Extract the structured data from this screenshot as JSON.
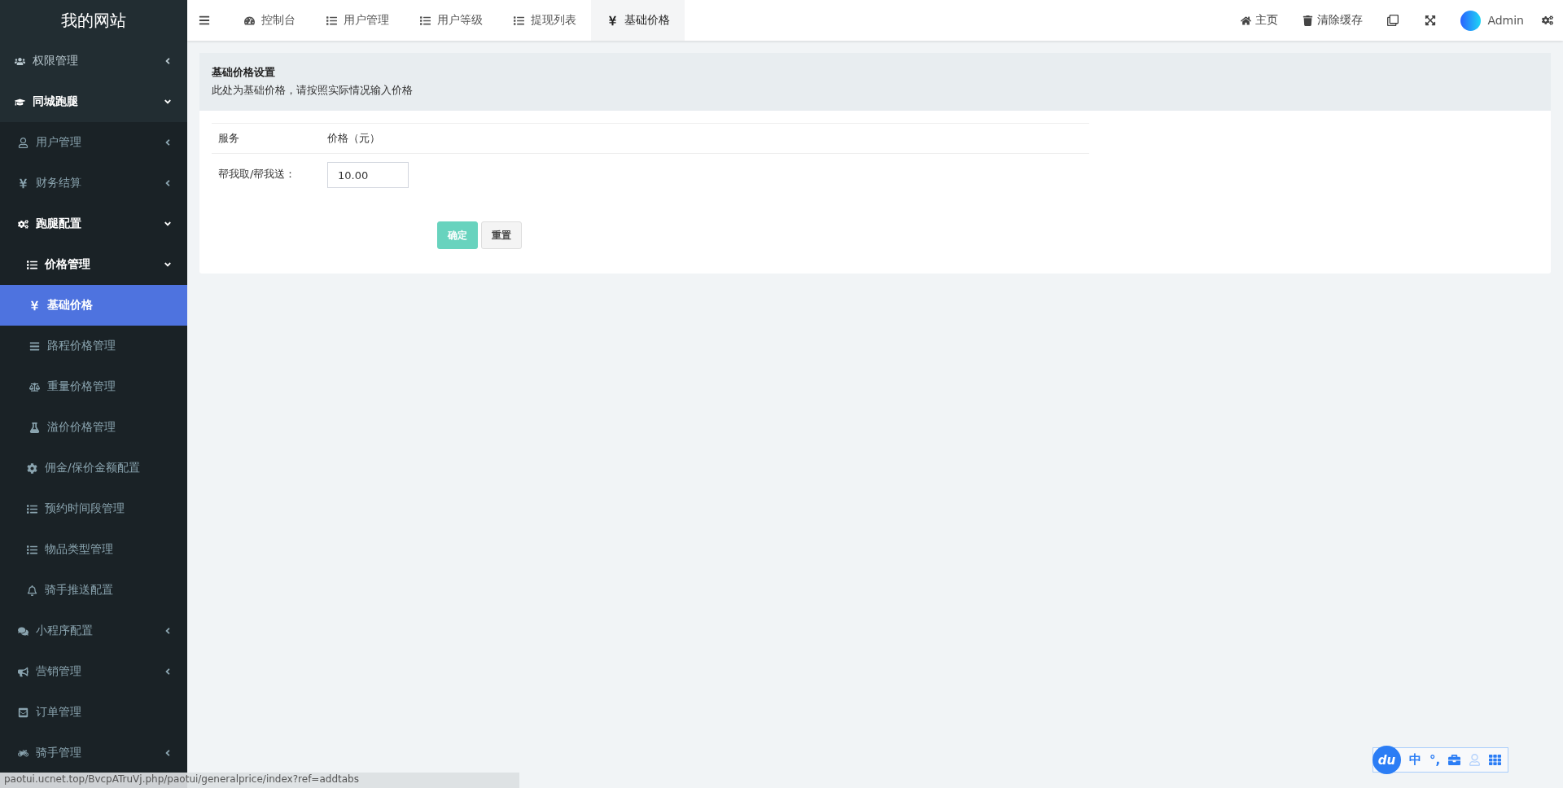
{
  "sidebar": {
    "logo": "我的网站",
    "items": [
      {
        "label": "权限管理",
        "expanded": false,
        "selected": false
      },
      {
        "label": "同城跑腿",
        "expanded": true,
        "selected": false,
        "children": [
          {
            "label": "用户管理",
            "expanded": false,
            "selected": false
          },
          {
            "label": "财务结算",
            "expanded": false,
            "selected": false
          },
          {
            "label": "跑腿配置",
            "expanded": true,
            "selected": false,
            "children": [
              {
                "label": "价格管理",
                "expanded": true,
                "selected": false,
                "children": [
                  {
                    "label": "基础价格",
                    "selected": true
                  },
                  {
                    "label": "路程价格管理",
                    "selected": false
                  },
                  {
                    "label": "重量价格管理",
                    "selected": false
                  },
                  {
                    "label": "溢价价格管理",
                    "selected": false
                  }
                ]
              },
              {
                "label": "佣金/保价金额配置",
                "selected": false
              },
              {
                "label": "预约时间段管理",
                "selected": false
              },
              {
                "label": "物品类型管理",
                "selected": false
              },
              {
                "label": "骑手推送配置",
                "selected": false
              }
            ]
          },
          {
            "label": "小程序配置",
            "expanded": false,
            "selected": false
          },
          {
            "label": "营销管理",
            "expanded": false,
            "selected": false
          },
          {
            "label": "订单管理",
            "selected": false
          },
          {
            "label": "骑手管理",
            "expanded": false,
            "selected": false
          }
        ]
      }
    ]
  },
  "topbar": {
    "tabs": [
      {
        "label": "控制台",
        "selected": false
      },
      {
        "label": "用户管理",
        "selected": false
      },
      {
        "label": "用户等级",
        "selected": false
      },
      {
        "label": "提现列表",
        "selected": false
      },
      {
        "label": "基础价格",
        "selected": true
      }
    ],
    "actions": [
      {
        "label": "主页"
      },
      {
        "label": "清除缓存"
      }
    ],
    "user": {
      "name": "Admin"
    }
  },
  "panel": {
    "title": "基础价格设置",
    "description": "此处为基础价格，请按照实际情况输入价格",
    "table": {
      "columns": [
        "服务",
        "价格（元）"
      ],
      "rows": [
        {
          "service": "帮我取/帮我送：",
          "price": "10.00"
        }
      ]
    },
    "buttons": [
      {
        "label": "确定",
        "kind": "primary",
        "disabled": true
      },
      {
        "label": "重置",
        "kind": "default",
        "disabled": false
      }
    ]
  },
  "status_bar": {
    "url": "paotui.ucnet.top/BvcpATruVj.php/paotui/generalprice/index?ref=addtabs"
  },
  "input_method": {
    "logo": "du",
    "mode": "中",
    "punctuation": "°,"
  }
}
